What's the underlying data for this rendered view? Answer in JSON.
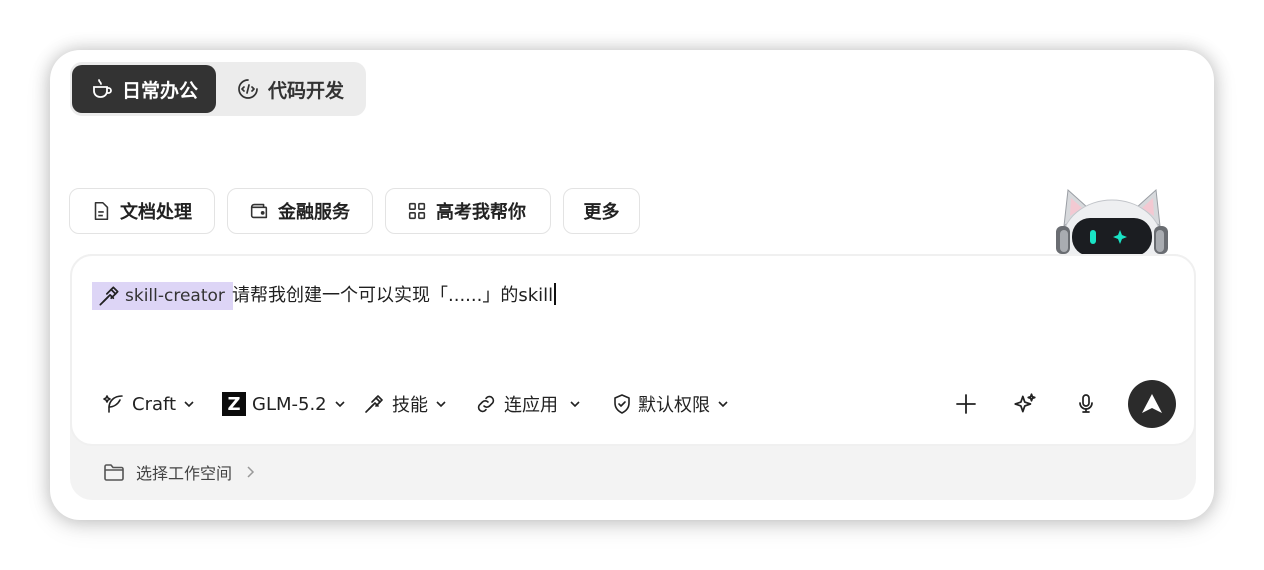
{
  "mode_tabs": [
    {
      "label": "日常办公",
      "icon": "coffee-cup-icon",
      "active": true
    },
    {
      "label": "代码开发",
      "icon": "code-icon",
      "active": false
    }
  ],
  "chips": [
    {
      "label": "文档处理",
      "icon": "document-icon"
    },
    {
      "label": "金融服务",
      "icon": "wallet-icon"
    },
    {
      "label": "高考我帮你",
      "icon": "grid-icon"
    },
    {
      "label": "更多",
      "icon": ""
    }
  ],
  "composer": {
    "skill_tag": "skill-creator",
    "prompt": "请帮我创建一个可以实现「......」的skill"
  },
  "toolbar": {
    "mode": "Craft",
    "model": "GLM-5.2",
    "model_logo": "Z",
    "skills": "技能",
    "connect_apps": "连应用",
    "permission": "默认权限"
  },
  "workspace": {
    "label": "选择工作空间"
  },
  "colors": {
    "active_tab": "#333333",
    "skill_tag_bg": "#ddd5f6",
    "send_button": "#2b2b2b",
    "panel_bg": "#f3f3f3"
  }
}
